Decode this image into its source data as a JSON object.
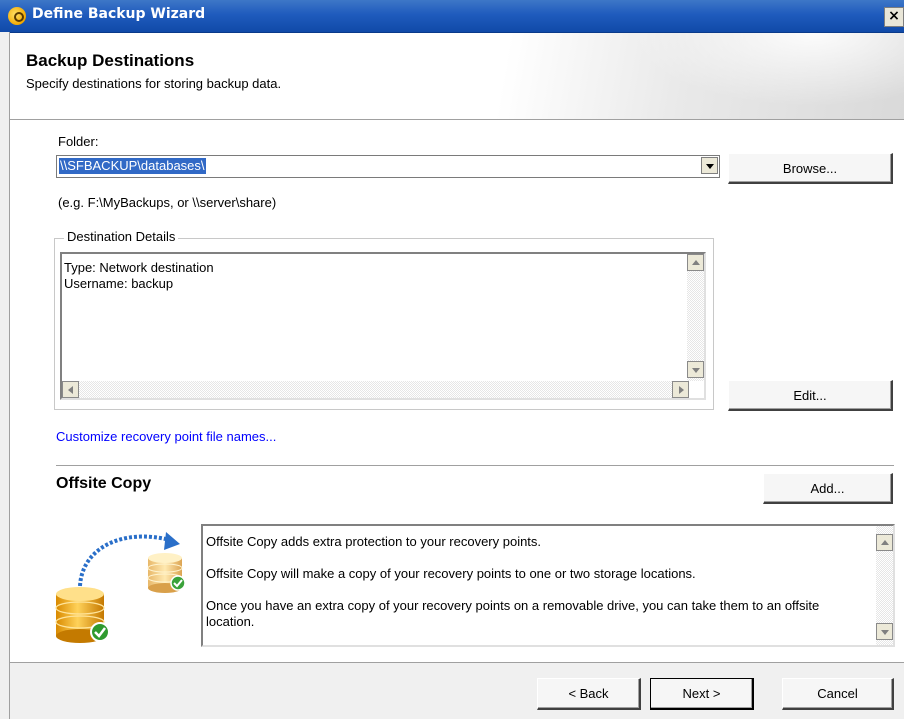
{
  "window": {
    "title": "Define Backup Wizard",
    "close_glyph": "×"
  },
  "header": {
    "title": "Backup Destinations",
    "subtitle": "Specify destinations for storing backup data."
  },
  "folder": {
    "label": "Folder:",
    "value": "\\\\SFBACKUP\\databases\\",
    "hint": "(e.g. F:\\MyBackups, or \\\\server\\share)",
    "browse_label": "Browse..."
  },
  "destination_details": {
    "legend": "Destination Details",
    "lines": [
      "Type: Network destination",
      "Username: backup"
    ],
    "edit_label": "Edit..."
  },
  "customize_link": "Customize recovery point file names...",
  "offsite": {
    "title": "Offsite Copy",
    "add_label": "Add...",
    "paragraphs": [
      "Offsite Copy adds extra protection to your recovery points.",
      "Offsite Copy will make a copy of your recovery points to one or two storage locations.",
      "Once you have an extra copy of your recovery points on a removable drive, you can take them to an offsite location."
    ]
  },
  "footer": {
    "back_label": "< Back",
    "next_label": "Next >",
    "cancel_label": "Cancel"
  },
  "icons": {
    "app": "app-icon",
    "close": "close-icon",
    "dropdown": "chevron-down-icon",
    "offsite_illustration": "database-copy-icon"
  },
  "colors": {
    "titlebar": "#1f5bbd",
    "link": "#0000ff",
    "selection": "#3169c6"
  }
}
